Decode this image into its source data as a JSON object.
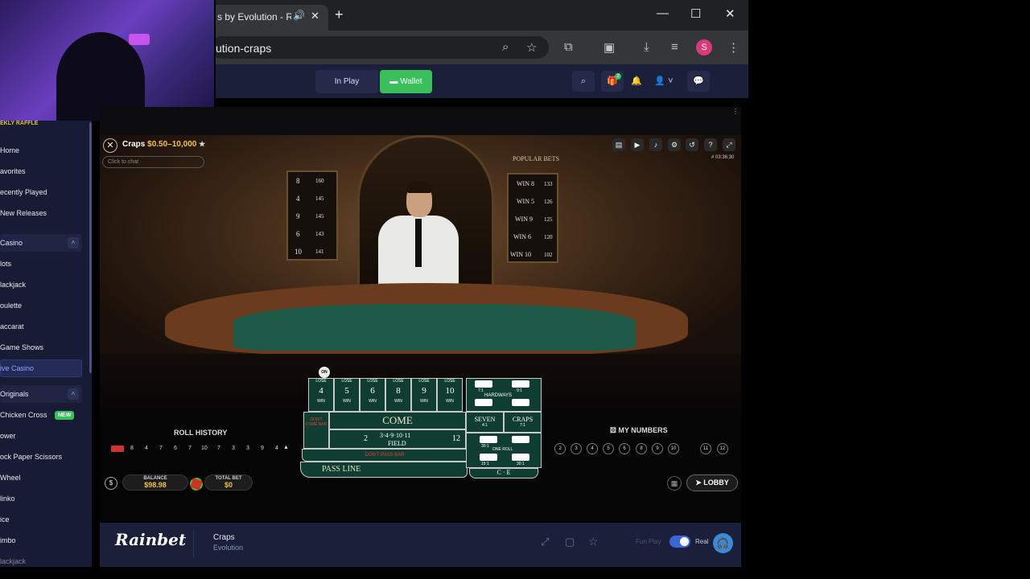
{
  "browser": {
    "tab_title": "s by Evolution - Ra",
    "url": "ution-craps",
    "profile_initial": "S"
  },
  "header": {
    "in_play": "In Play",
    "wallet": "Wallet",
    "gift_count": "2"
  },
  "sidebar": {
    "raffle": "EKLY RAFFLE",
    "items": [
      "Home",
      "avorites",
      "ecently Played",
      "New Releases"
    ],
    "casino_header": "Casino",
    "casino_items": [
      "lots",
      "lackjack",
      "oulette",
      "accarat",
      "Game Shows",
      "ive Casino"
    ],
    "originals_header": "Originals",
    "originals_items": [
      "Chicken Cross",
      "ower",
      "ock Paper Scissors",
      "Wheel",
      "linko",
      "ice",
      "imbo",
      "lackjack"
    ],
    "new_badge": "NEW"
  },
  "game": {
    "name": "Craps",
    "limits": "$0.50–10,000",
    "chat_placeholder": "Click to chat",
    "clock": "# 03:36:30",
    "hot_numbers": [
      {
        "num": "8",
        "count": "160"
      },
      {
        "num": "4",
        "count": "145"
      },
      {
        "num": "9",
        "count": "145"
      },
      {
        "num": "6",
        "count": "143"
      },
      {
        "num": "10",
        "count": "141"
      }
    ],
    "popular_bets_title": "POPULAR BETS",
    "popular_bets": [
      {
        "label": "WIN 8",
        "count": "133"
      },
      {
        "label": "WIN 5",
        "count": "126"
      },
      {
        "label": "WIN 9",
        "count": "125"
      },
      {
        "label": "WIN 6",
        "count": "120"
      },
      {
        "label": "WIN 10",
        "count": "102"
      }
    ],
    "layout": {
      "on_marker": "ON",
      "lose": "LOSE",
      "win": "WIN",
      "points": [
        "4",
        "5",
        "6",
        "8",
        "9",
        "10"
      ],
      "dont_come_bar": "DON'T COME BAR",
      "come": "COME",
      "field": "FIELD",
      "field_numbers": "3·4·9·10·11",
      "field_2": "2",
      "field_12": "12",
      "dont_pass_bar": "DON'T PASS BAR",
      "pass_line": "PASS LINE",
      "hardways": "HARDWAYS",
      "seven": "SEVEN",
      "craps": "CRAPS",
      "one_roll": "ONE ROLL",
      "ce": "C · E",
      "odds_9_1": "9:1",
      "odds_7_1": "7:1",
      "odds_4_1": "4:1",
      "odds_30_1": "30:1",
      "odds_15_1": "15:1"
    },
    "roll_history_title": "ROLL HISTORY",
    "roll_history": [
      "8",
      "4",
      "7",
      "6",
      "7",
      "10",
      "7",
      "3",
      "3",
      "9",
      "4"
    ],
    "my_numbers_title": "MY NUMBERS",
    "my_numbers": [
      "2",
      "3",
      "4",
      "5",
      "6",
      "8",
      "9",
      "10",
      "11",
      "12"
    ],
    "balance_label": "BALANCE",
    "balance": "$98.98",
    "total_bet_label": "TOTAL BET",
    "total_bet": "$0",
    "lobby": "LOBBY"
  },
  "footer": {
    "logo": "Rainbet",
    "game_title": "Craps",
    "provider": "Evolution",
    "fun_play": "Fun Play",
    "real": "Real"
  }
}
